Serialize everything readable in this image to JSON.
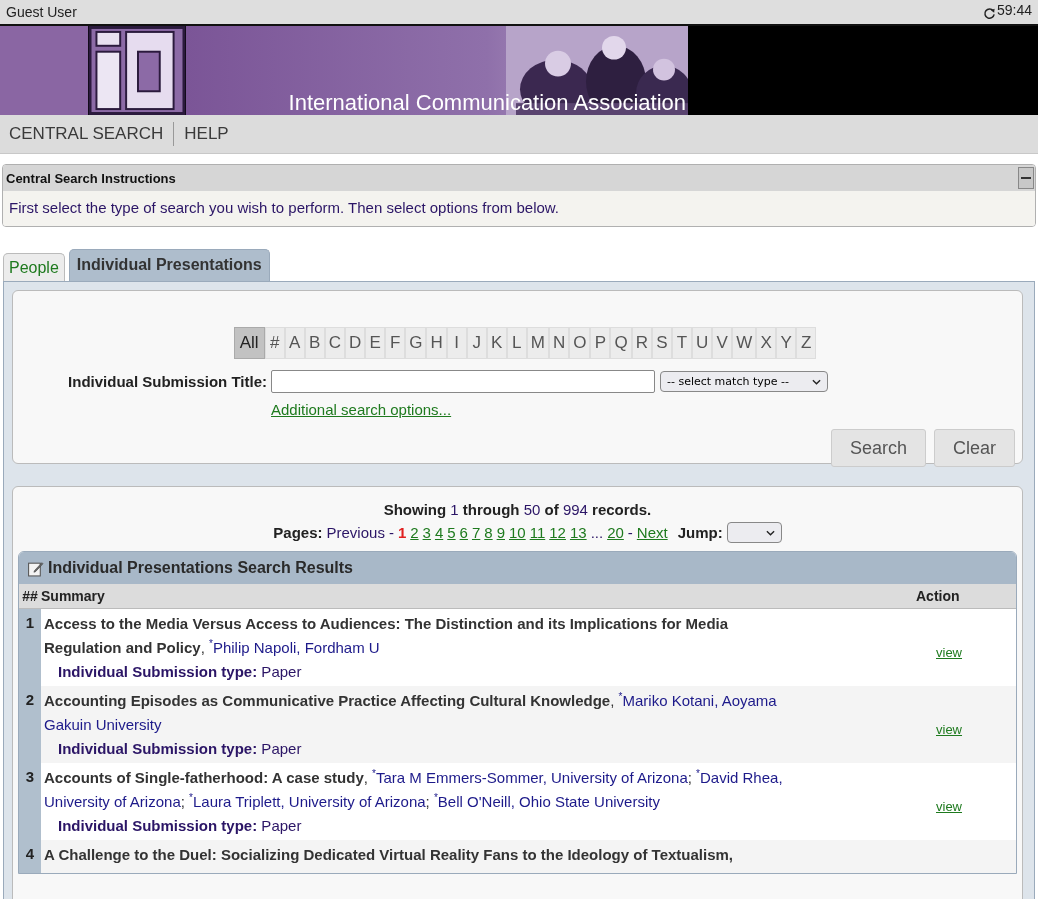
{
  "session": {
    "user": "Guest User",
    "timer": "59:44"
  },
  "banner": {
    "title": "International Communication Association"
  },
  "nav": [
    {
      "label": "CENTRAL SEARCH"
    },
    {
      "label": "HELP"
    }
  ],
  "instructions": {
    "title": "Central Search Instructions",
    "text": "First select the type of search you wish to perform. Then select options from below."
  },
  "tabs": [
    {
      "label": "People",
      "selected": false
    },
    {
      "label": "Individual Presentations",
      "selected": true
    }
  ],
  "letters": [
    {
      "label": "All",
      "selected": true
    },
    {
      "label": "#",
      "selected": false
    },
    {
      "label": "A",
      "selected": false
    },
    {
      "label": "B",
      "selected": false
    },
    {
      "label": "C",
      "selected": false
    },
    {
      "label": "D",
      "selected": false
    },
    {
      "label": "E",
      "selected": false
    },
    {
      "label": "F",
      "selected": false
    },
    {
      "label": "G",
      "selected": false
    },
    {
      "label": "H",
      "selected": false
    },
    {
      "label": "I",
      "selected": false
    },
    {
      "label": "J",
      "selected": false
    },
    {
      "label": "K",
      "selected": false
    },
    {
      "label": "L",
      "selected": false
    },
    {
      "label": "M",
      "selected": false
    },
    {
      "label": "N",
      "selected": false
    },
    {
      "label": "O",
      "selected": false
    },
    {
      "label": "P",
      "selected": false
    },
    {
      "label": "Q",
      "selected": false
    },
    {
      "label": "R",
      "selected": false
    },
    {
      "label": "S",
      "selected": false
    },
    {
      "label": "T",
      "selected": false
    },
    {
      "label": "U",
      "selected": false
    },
    {
      "label": "V",
      "selected": false
    },
    {
      "label": "W",
      "selected": false
    },
    {
      "label": "X",
      "selected": false
    },
    {
      "label": "Y",
      "selected": false
    },
    {
      "label": "Z",
      "selected": false
    }
  ],
  "search": {
    "label": "Individual Submission Title:",
    "match_type": "-- select match type --",
    "more_options": "Additional search options...",
    "buttons": [
      "Search",
      "Clear"
    ]
  },
  "showing": [
    {
      "kind": "text",
      "text": "Showing"
    },
    {
      "kind": "count",
      "text": "1"
    },
    {
      "kind": "text",
      "text": "through"
    },
    {
      "kind": "count",
      "text": "50"
    },
    {
      "kind": "text",
      "text": "of"
    },
    {
      "kind": "count",
      "text": "994"
    },
    {
      "kind": "text",
      "text": "records."
    }
  ],
  "pager": [
    {
      "kind": "label",
      "text": "Pages:"
    },
    {
      "kind": "inactive",
      "text": "Previous"
    },
    {
      "kind": "sep",
      "text": "-"
    },
    {
      "kind": "page",
      "text": "1",
      "selected": true
    },
    {
      "kind": "page",
      "text": "2",
      "selected": false
    },
    {
      "kind": "page",
      "text": "3",
      "selected": false
    },
    {
      "kind": "page",
      "text": "4",
      "selected": false
    },
    {
      "kind": "page",
      "text": "5",
      "selected": false
    },
    {
      "kind": "page",
      "text": "6",
      "selected": false
    },
    {
      "kind": "page",
      "text": "7",
      "selected": false
    },
    {
      "kind": "page",
      "text": "8",
      "selected": false
    },
    {
      "kind": "page",
      "text": "9",
      "selected": false
    },
    {
      "kind": "page",
      "text": "10",
      "selected": false
    },
    {
      "kind": "page",
      "text": "11",
      "selected": false
    },
    {
      "kind": "page",
      "text": "12",
      "selected": false
    },
    {
      "kind": "page",
      "text": "13",
      "selected": false
    },
    {
      "kind": "gap",
      "text": "..."
    },
    {
      "kind": "page",
      "text": "20",
      "selected": false
    },
    {
      "kind": "sep",
      "text": "-"
    },
    {
      "kind": "link",
      "text": "Next"
    }
  ],
  "jump": {
    "label": "Jump:"
  },
  "table": {
    "title": "Individual Presentations Search Results",
    "columns": [
      "##",
      "Summary",
      "Action"
    ],
    "rows": [
      {
        "number": "1",
        "parts": [
          {
            "kind": "title",
            "text": "Access to the Media Versus Access to Audiences: The Distinction and its Implications for Media Regulation and Policy"
          },
          {
            "kind": "sep",
            "text": ", "
          },
          {
            "kind": "author",
            "text": "$^{*}$Philip Napoli, Fordham U"
          }
        ],
        "type_label": "Individual Submission type:",
        "type": "Paper",
        "action": "view"
      },
      {
        "number": "2",
        "parts": [
          {
            "kind": "title",
            "text": "Accounting Episodes as Communicative Practice Affecting Cultural Knowledge"
          },
          {
            "kind": "sep",
            "text": ", "
          },
          {
            "kind": "author",
            "text": "$^{*}$Mariko Kotani, Aoyama Gakuin University"
          }
        ],
        "type_label": "Individual Submission type:",
        "type": "Paper",
        "action": "view"
      },
      {
        "number": "3",
        "parts": [
          {
            "kind": "title",
            "text": "Accounts of Single-fatherhood: A case study"
          },
          {
            "kind": "sep",
            "text": ", "
          },
          {
            "kind": "author",
            "text": "$^{*}$Tara M Emmers-Sommer, University of Arizona"
          },
          {
            "kind": "sep",
            "text": "; "
          },
          {
            "kind": "author",
            "text": "$^{*}$David Rhea, University of Arizona"
          },
          {
            "kind": "sep",
            "text": "; "
          },
          {
            "kind": "author",
            "text": "$^{*}$Laura Triplett, University of Arizona"
          },
          {
            "kind": "sep",
            "text": "; "
          },
          {
            "kind": "author",
            "text": "$^{*}$Bell O'Neill, Ohio State University"
          }
        ],
        "type_label": "Individual Submission type:",
        "type": "Paper",
        "action": "view"
      },
      {
        "number": "4",
        "parts": [
          {
            "kind": "title",
            "text": "A Challenge to the Duel: Socializing Dedicated Virtual Reality Fans to the Ideology of Textualism,"
          }
        ]
      }
    ]
  }
}
